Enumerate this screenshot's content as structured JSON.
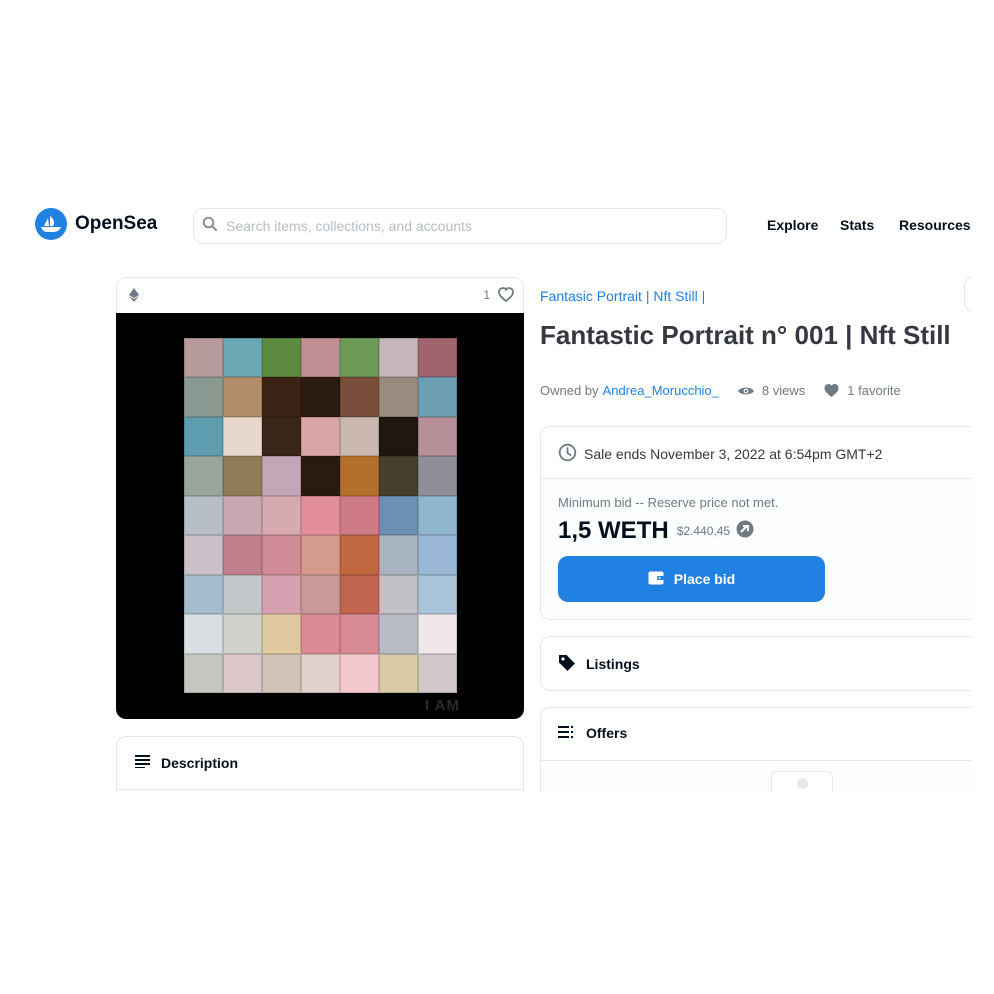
{
  "header": {
    "brand": "OpenSea",
    "search_placeholder": "Search items, collections, and accounts",
    "nav": [
      "Explore",
      "Stats",
      "Resources"
    ]
  },
  "item": {
    "favorite_count": "1",
    "collection": "Fantasic Portrait | Nft Still |",
    "title": "Fantastic Portrait n° 001 | Nft Still",
    "owned_by_label": "Owned by",
    "owner": "Andrea_Morucchio_",
    "views": "8 views",
    "favorites": "1 favorite",
    "art_caption": "I AM"
  },
  "sale": {
    "ends": "Sale ends November 3, 2022 at 6:54pm GMT+2",
    "min_bid_label": "Minimum bid -- Reserve price not met.",
    "price": "1,5 WETH",
    "price_usd": "$2.440,45",
    "place_bid_label": "Place bid"
  },
  "panels": {
    "description": "Description",
    "listings": "Listings",
    "offers": "Offers"
  },
  "colors": {
    "accent": "#2081e2",
    "text_dark": "#04111d",
    "text_muted": "#707a83",
    "border": "#e5e8eb"
  },
  "icons": {
    "logo": "opensea-boat-icon",
    "search": "search-icon",
    "eth": "ethereum-icon",
    "heart": "heart-icon",
    "eye": "eye-icon",
    "clock": "clock-icon",
    "weth": "weth-icon",
    "wallet": "wallet-icon",
    "tag": "tag-icon",
    "description": "lines-icon",
    "offers": "list-icon"
  },
  "artwork_palette": [
    "#b79a9c",
    "#6aa9b4",
    "#5d8a3f",
    "#c08f94",
    "#6e9a55",
    "#c4b6ba",
    "#a0646f",
    "#8a9a93",
    "#b38c6c",
    "#3b2416",
    "#2b1a12",
    "#7a4d3a",
    "#9b8b7e",
    "#6c9fb4",
    "#5e9cb0",
    "#e7d7cc",
    "#3a2519",
    "#d8a6a4",
    "#c9b7b0",
    "#1e1712",
    "#b78f98",
    "#9aa59b",
    "#8f7c56",
    "#c4a7b7",
    "#2a1a0f",
    "#b46f2d",
    "#45402c",
    "#8e8f97",
    "#b7bec7",
    "#c9a8b2",
    "#d7a9b1",
    "#e38f9b",
    "#cf7b87",
    "#6c8fb2",
    "#8fb5cf",
    "#c9c0c8",
    "#c07f8d",
    "#cf8b96",
    "#d49a8c",
    "#c06740",
    "#a8b4bf",
    "#9bb8d6",
    "#a6bccd",
    "#c5c8cb",
    "#d6a1b0",
    "#c99a9c",
    "#c16550",
    "#c2c0c4",
    "#a9c3d9",
    "#d9dee3",
    "#cfd3cb",
    "#e0c9a0",
    "#dc8b95",
    "#d78a95",
    "#b7bcc5",
    "#f1e7ea",
    "#c6c6c0",
    "#dcc7c9",
    "#cfc3b6",
    "#e1d0c9",
    "#f3c9cf",
    "#d8c9a7",
    "#d0c7c8"
  ]
}
